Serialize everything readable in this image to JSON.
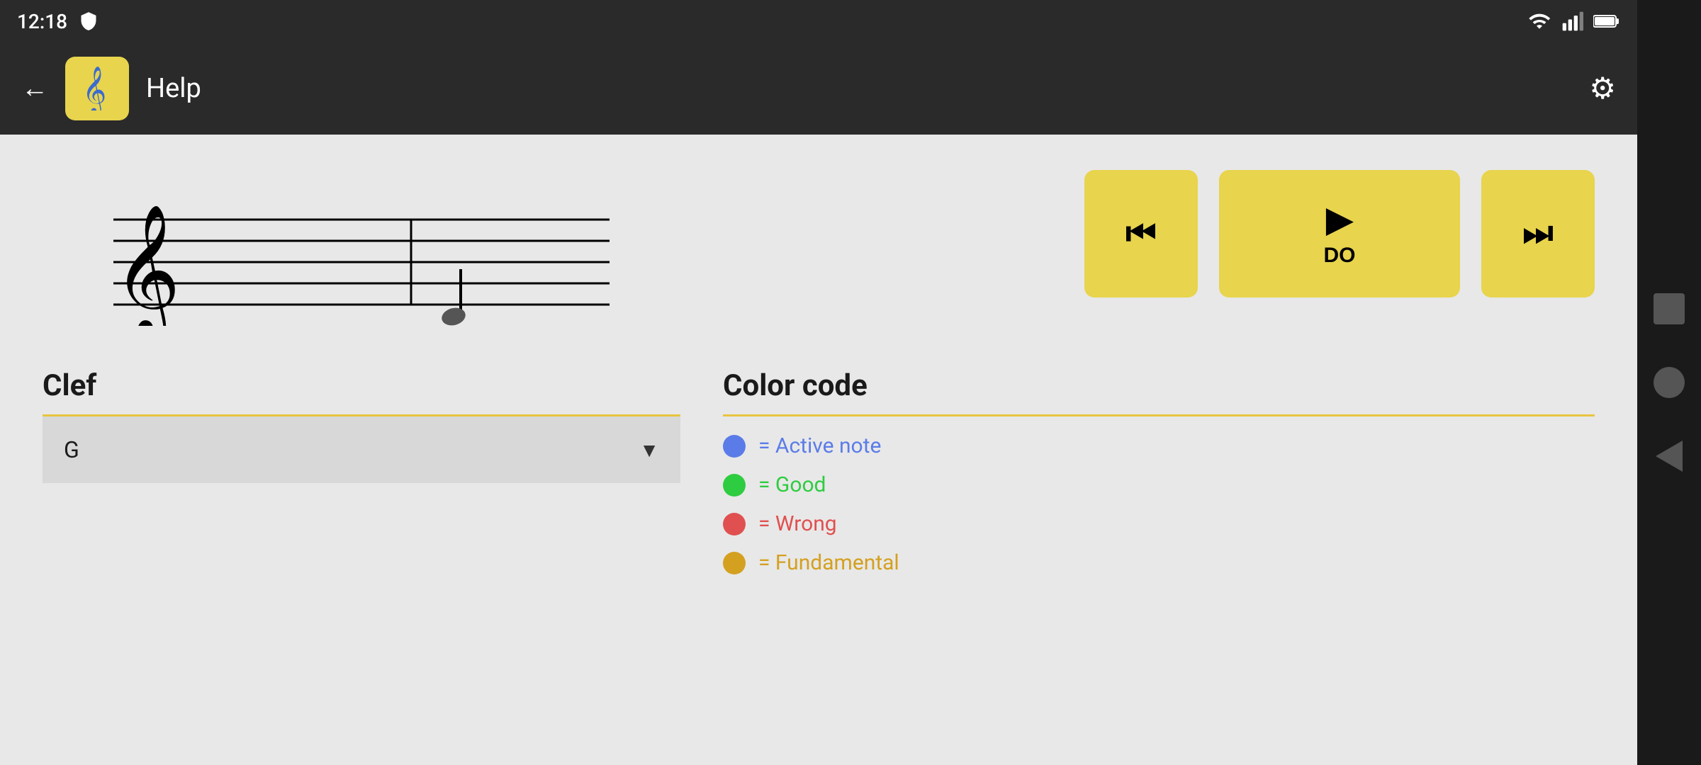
{
  "status_bar": {
    "time": "12:18",
    "icons_right": [
      "wifi",
      "signal",
      "battery"
    ]
  },
  "header": {
    "back_label": "←",
    "title": "Help",
    "settings_icon": "⚙"
  },
  "playback": {
    "prev_icon": "⏮",
    "play_icon": "▶",
    "play_label": "DO",
    "next_icon": "⏭"
  },
  "clef": {
    "title": "Clef",
    "selected_value": "G",
    "dropdown_arrow": "▼"
  },
  "color_code": {
    "title": "Color code",
    "items": [
      {
        "color": "#5b7ce8",
        "label": "= Active note"
      },
      {
        "color": "#2ecc40",
        "label": "= Good"
      },
      {
        "color": "#e05050",
        "label": "= Wrong"
      },
      {
        "color": "#d4a020",
        "label": "= Fundamental"
      }
    ]
  },
  "side_nav": {
    "buttons": [
      "square",
      "circle",
      "triangle"
    ]
  }
}
